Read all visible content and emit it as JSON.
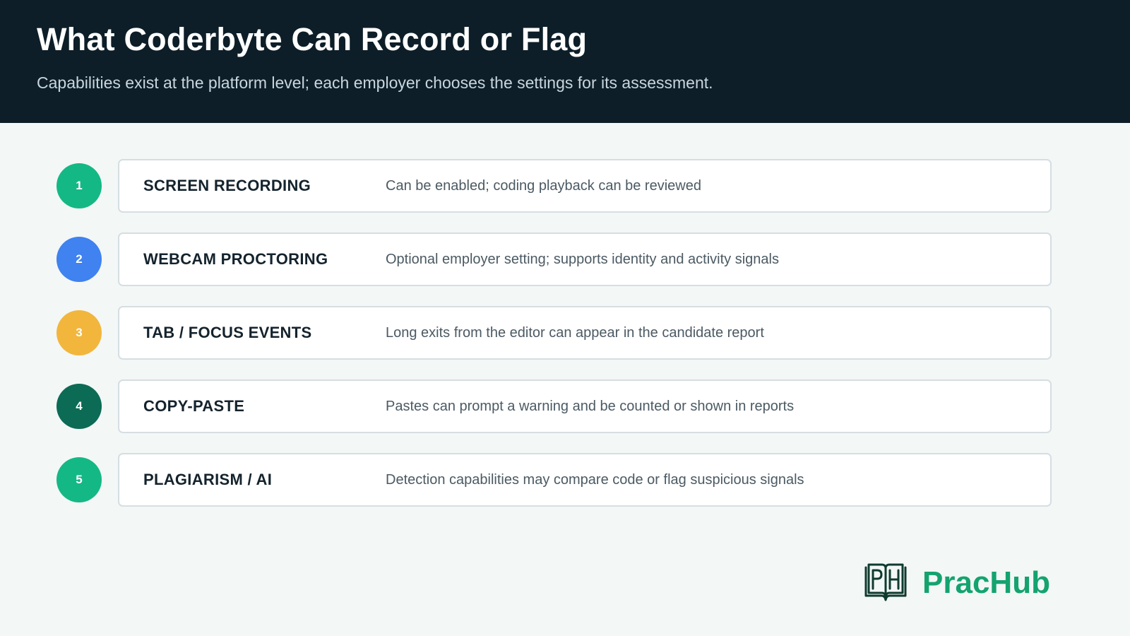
{
  "header": {
    "title": "What Coderbyte Can Record or Flag",
    "subtitle": "Capabilities exist at the platform level; each employer chooses the settings for its assessment."
  },
  "items": [
    {
      "number": "1",
      "label": "SCREEN RECORDING",
      "description": "Can be enabled; coding playback can be reviewed",
      "color": "#14b885"
    },
    {
      "number": "2",
      "label": "WEBCAM PROCTORING",
      "description": "Optional employer setting; supports identity and activity signals",
      "color": "#3f82f0"
    },
    {
      "number": "3",
      "label": "TAB / FOCUS EVENTS",
      "description": "Long exits from the editor can appear in the candidate report",
      "color": "#f2b63d"
    },
    {
      "number": "4",
      "label": "COPY-PASTE",
      "description": "Pastes can prompt a warning and be counted or shown in reports",
      "color": "#0c6b55"
    },
    {
      "number": "5",
      "label": "PLAGIARISM / AI",
      "description": "Detection capabilities may compare code or flag suspicious signals",
      "color": "#14b885"
    }
  ],
  "brand": {
    "name": "PracHub",
    "icon": "book-icon",
    "color": "#14a36f"
  }
}
